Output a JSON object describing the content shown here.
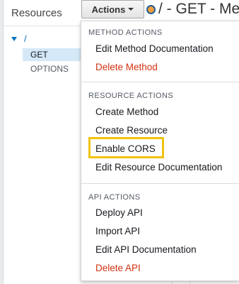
{
  "resources_panel": {
    "title": "Resources",
    "tree": {
      "root": "/",
      "methods": [
        "GET",
        "OPTIONS"
      ]
    }
  },
  "toolbar": {
    "actions_label": "Actions",
    "page_title": "/ - GET - Me"
  },
  "actions_menu": {
    "sections": [
      {
        "title": "METHOD ACTIONS",
        "items": [
          "Edit Method Documentation",
          "Delete Method"
        ]
      },
      {
        "title": "RESOURCE ACTIONS",
        "items": [
          "Create Method",
          "Create Resource",
          "Enable CORS",
          "Edit Resource Documentation"
        ]
      },
      {
        "title": "API ACTIONS",
        "items": [
          "Deploy API",
          "Import API",
          "Edit API Documentation",
          "Delete API"
        ]
      }
    ],
    "highlighted_item": "Enable CORS"
  },
  "colors": {
    "danger": "#d13212",
    "highlight": "#f2c30f",
    "selected_row": "#d4e8f7",
    "link": "#0073bb"
  }
}
